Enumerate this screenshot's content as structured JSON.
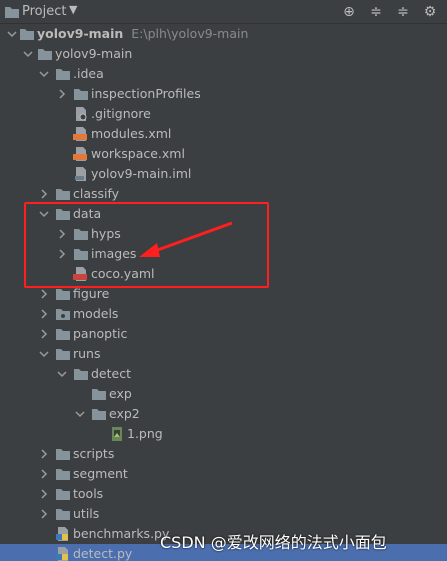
{
  "toolbar": {
    "title": "Project",
    "dropdown_glyph": "▼",
    "buttons": [
      {
        "name": "locate-icon",
        "glyph": "⊕"
      },
      {
        "name": "collapse-all-icon",
        "glyph": "≑"
      },
      {
        "name": "expand-all-icon",
        "glyph": "≑"
      },
      {
        "name": "gear-icon",
        "glyph": "⚙"
      }
    ]
  },
  "tree": {
    "root_name": "yolov9-main",
    "root_path": "E:\\plh\\yolov9-main",
    "items": [
      "yolov9-main",
      ".idea",
      "inspectionProfiles",
      ".gitignore",
      "modules.xml",
      "workspace.xml",
      "yolov9-main.iml",
      "classify",
      "data",
      "hyps",
      "images",
      "coco.yaml",
      "figure",
      "models",
      "panoptic",
      "runs",
      "detect",
      "exp",
      "exp2",
      "1.png",
      "scripts",
      "segment",
      "tools",
      "utils",
      "benchmarks.py",
      "detect.py"
    ]
  },
  "watermark": "CSDN @爱改网络的法式小面包",
  "colors": {
    "background": "#3c3f41",
    "selection": "#4b6eaf",
    "folder": "#87939a",
    "annotation": "#ff1f1f"
  }
}
